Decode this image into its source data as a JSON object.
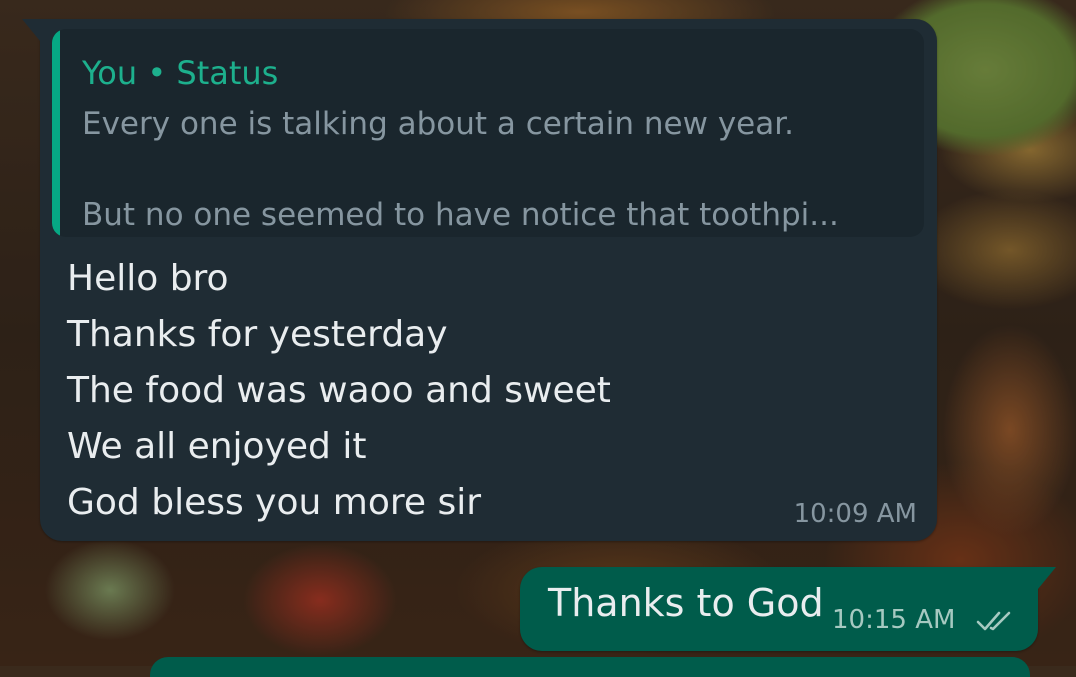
{
  "incoming_message": {
    "quoted": {
      "author": "You • Status",
      "line1": "Every one is talking about a certain new year.",
      "line2": "But no one seemed to have notice that toothpi..."
    },
    "lines": [
      "Hello bro",
      "Thanks for yesterday",
      "The food was waoo and sweet",
      "We all enjoyed it",
      "God  bless you more sir"
    ],
    "time": "10:09 AM"
  },
  "outgoing_message": {
    "text": "Thanks to God",
    "time": "10:15 AM",
    "status_icon": "double-check-icon"
  },
  "colors": {
    "incoming_bubble": "#1f2c34",
    "outgoing_bubble": "#005c4b",
    "accent": "#06a884"
  }
}
